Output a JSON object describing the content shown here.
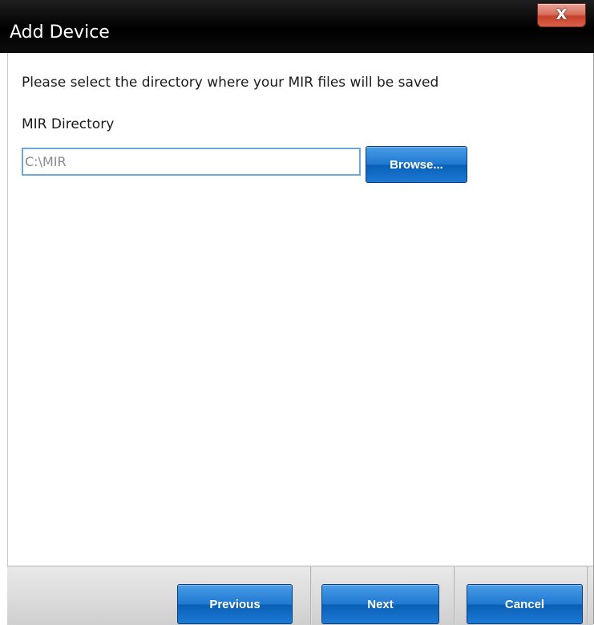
{
  "window": {
    "title": "Add Device",
    "close_label": "X"
  },
  "content": {
    "prompt": "Please select the directory where your MIR files will be saved",
    "directory_label": "MIR Directory",
    "directory_value": "C:\\MIR",
    "browse_label": "Browse..."
  },
  "footer": {
    "previous_label": "Previous",
    "next_label": "Next",
    "cancel_label": "Cancel"
  },
  "colors": {
    "title_bar": "#000000",
    "close_button": "#c7412a",
    "primary_button": "#1f78d1",
    "input_border": "#6fa9dc"
  },
  "icons": {
    "close": "close-icon"
  }
}
